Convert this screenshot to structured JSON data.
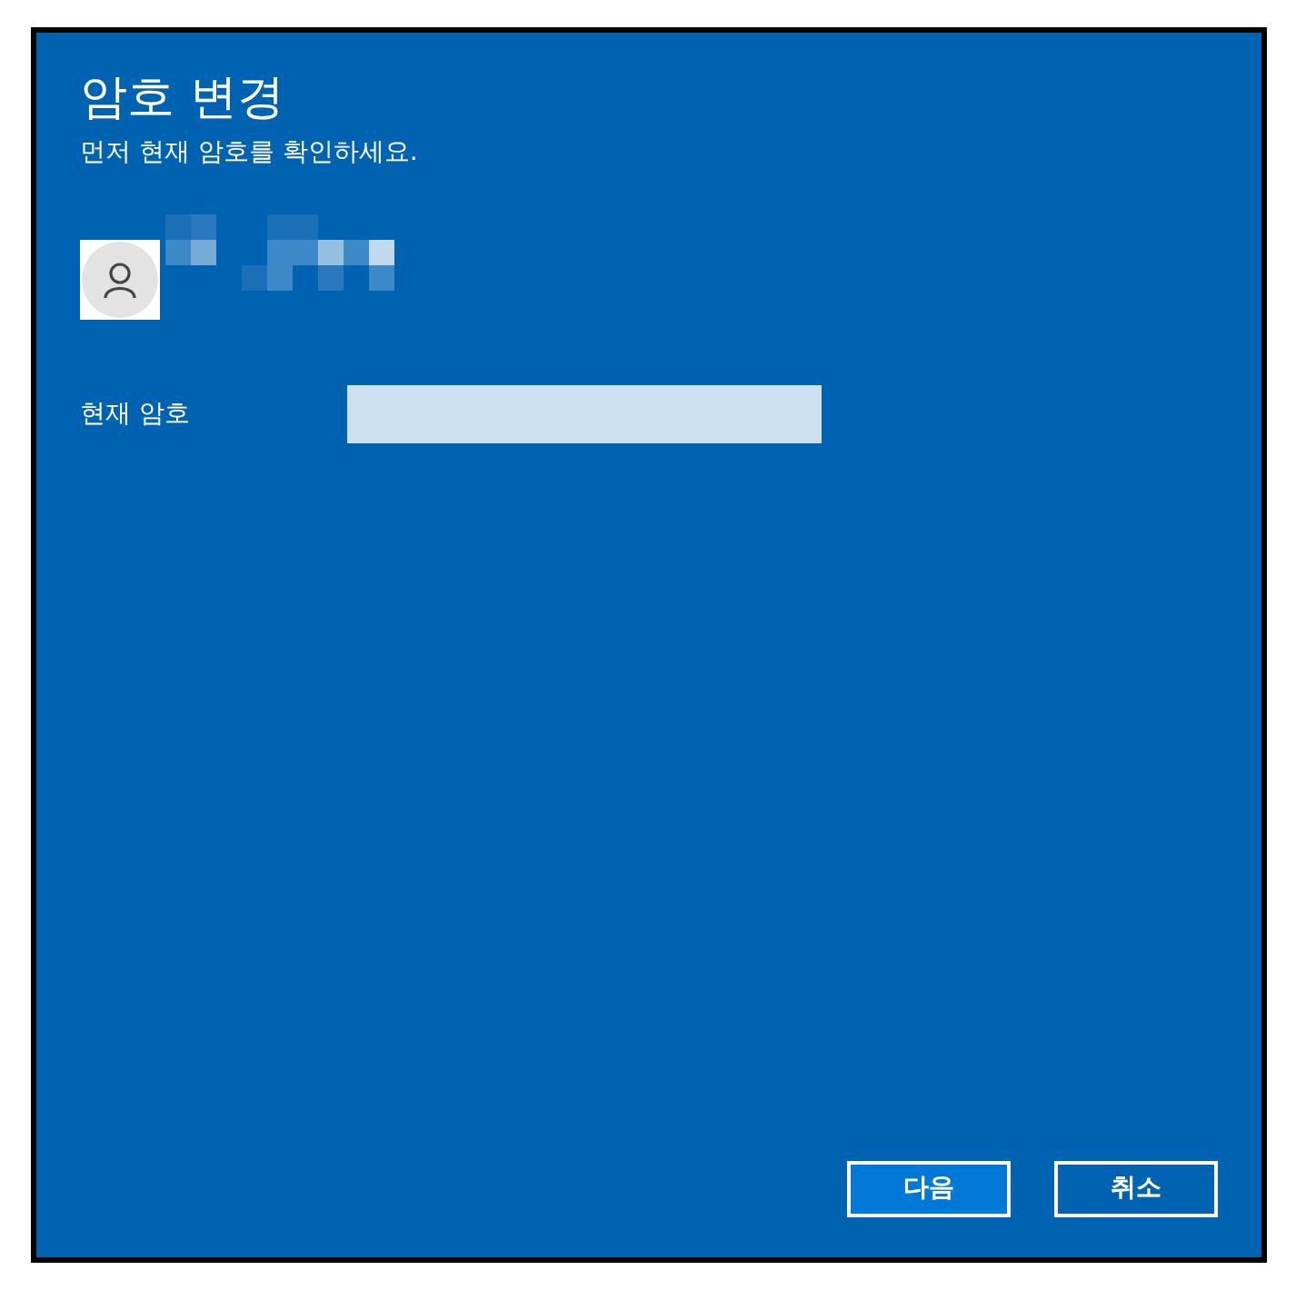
{
  "dialog": {
    "title": "암호 변경",
    "subtitle": "먼저 현재 암호를 확인하세요."
  },
  "password_field": {
    "label": "현재 암호"
  },
  "buttons": [
    {
      "label": "다음",
      "primary": true
    },
    {
      "label": "취소",
      "primary": false
    }
  ]
}
